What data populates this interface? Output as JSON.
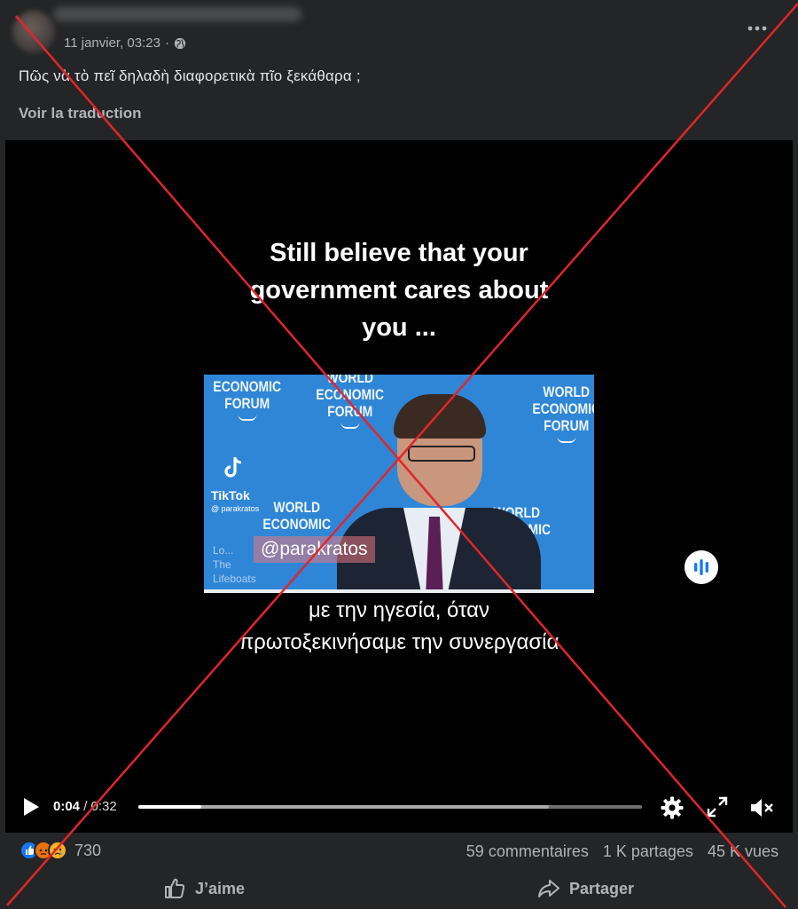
{
  "post": {
    "date": "11 janvier, 03:23",
    "separator": "·",
    "privacy_icon": "globe-icon",
    "more_icon": "more-icon",
    "text": "Πῶς νὰ τὸ πεῖ δηλαδὴ διαφορετικὰ πῖο ξεκάθαρα ;",
    "see_translation": "Voir la traduction"
  },
  "video": {
    "overlay_line1": "Still believe that your",
    "overlay_line2": "government cares about",
    "overlay_line3": "you ...",
    "clip": {
      "wef_line1": "WORLD",
      "wef_line2": "ECONOMIC",
      "wef_line3": "FORUM",
      "tiktok_name": "TikTok",
      "tiktok_handle": "@ parakratos",
      "handle_badge": "@parakratos",
      "lifeboats_line1": "Lo...",
      "lifeboats_line2": "The",
      "lifeboats_line3": "Lifeboats"
    },
    "subtitle_line1": "με την ηγεσία, όταν",
    "subtitle_line2": "πρωτοξεκινήσαμε την συνεργασία",
    "controls": {
      "current_time": "0:04",
      "time_separator": "/",
      "total_time": "0:32",
      "progress_fraction": 0.125,
      "buffer_fraction": 0.815
    }
  },
  "stats": {
    "reactions": [
      "like",
      "angry",
      "sad"
    ],
    "reaction_count": "730",
    "comments": "59 commentaires",
    "shares": "1 K partages",
    "views": "45 K vues"
  },
  "actions": {
    "like": "J’aime",
    "share": "Partager"
  },
  "colors": {
    "background": "#242526",
    "video_bg": "#000000",
    "text_primary": "#e4e6eb",
    "text_secondary": "#b0b3b8",
    "like_blue": "#1877f2",
    "cross_red": "#e0262b"
  }
}
